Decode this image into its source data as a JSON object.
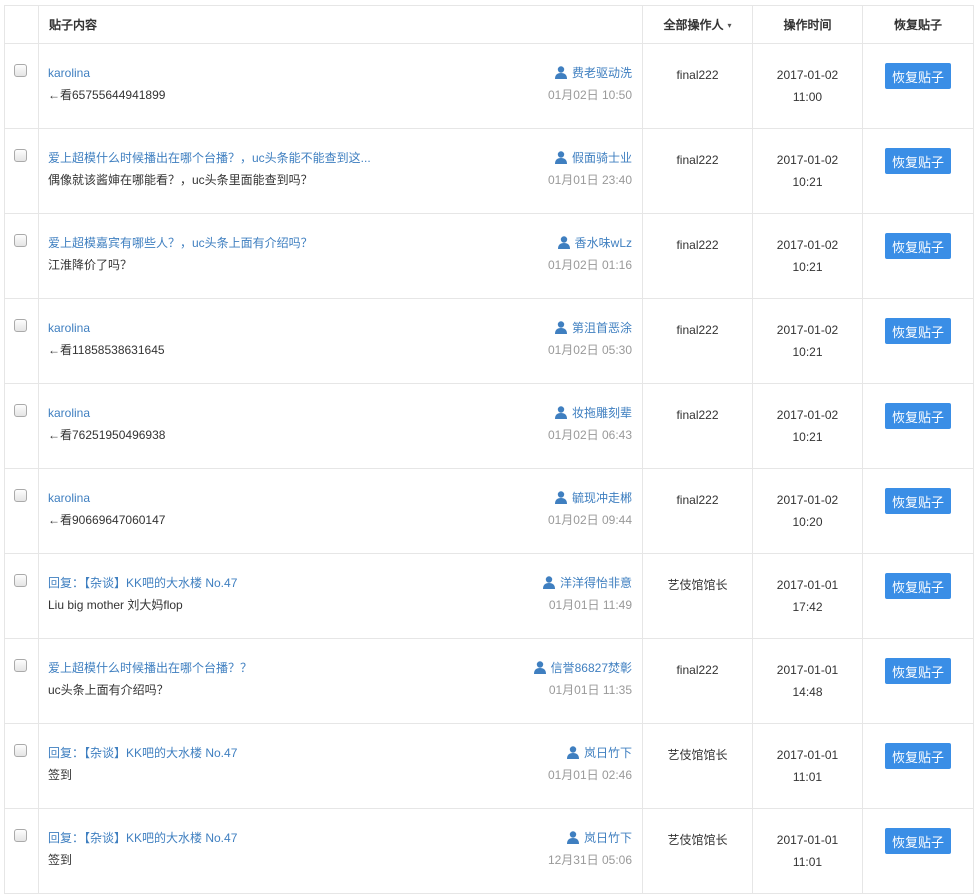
{
  "header": {
    "content": "贴子内容",
    "operator": "全部操作人",
    "operator_caret": "▾",
    "time": "操作时间",
    "restore": "恢复贴子"
  },
  "restore_button_label": "恢复贴子",
  "rows": [
    {
      "title": "karolina",
      "body": "←看65755644941899",
      "author": "费老驱动洗",
      "date": "01月02日 10:50",
      "operator": "final222",
      "time_date": "2017-01-02",
      "time_clock": "11:00"
    },
    {
      "title": "爱上超模什么时候播出在哪个台播？，uc头条能不能查到这...",
      "body": "偶像就该酱婶在哪能看？，uc头条里面能查到吗？",
      "author": "假面骑士业",
      "date": "01月01日 23:40",
      "operator": "final222",
      "time_date": "2017-01-02",
      "time_clock": "10:21"
    },
    {
      "title": "爱上超模嘉宾有哪些人？，uc头条上面有介绍吗？",
      "body": "江淮降价了吗？",
      "author": "香水味wLz",
      "date": "01月02日 01:16",
      "operator": "final222",
      "time_date": "2017-01-02",
      "time_clock": "10:21"
    },
    {
      "title": "karolina",
      "body": "←看11858538631645",
      "author": "第沮首恶涂",
      "date": "01月02日 05:30",
      "operator": "final222",
      "time_date": "2017-01-02",
      "time_clock": "10:21"
    },
    {
      "title": "karolina",
      "body": "←看76251950496938",
      "author": "妆拖雕刻辈",
      "date": "01月02日 06:43",
      "operator": "final222",
      "time_date": "2017-01-02",
      "time_clock": "10:21"
    },
    {
      "title": "karolina",
      "body": "←看90669647060147",
      "author": "毓现冲走郴",
      "date": "01月02日 09:44",
      "operator": "final222",
      "time_date": "2017-01-02",
      "time_clock": "10:20"
    },
    {
      "title": "回复：【杂谈】KK吧的大水楼 No.47",
      "body": "Liu big mother 刘大妈flop",
      "author": "洋洋得怡非意",
      "date": "01月01日 11:49",
      "operator": "艺伎馆馆长",
      "time_date": "2017-01-01",
      "time_clock": "17:42"
    },
    {
      "title": "爱上超模什么时候播出在哪个台播？？",
      "body": "uc头条上面有介绍吗？",
      "author": "信誉86827焚彰",
      "date": "01月01日 11:35",
      "operator": "final222",
      "time_date": "2017-01-01",
      "time_clock": "14:48"
    },
    {
      "title": "回复：【杂谈】KK吧的大水楼 No.47",
      "body": "签到",
      "author": "岚日竹下",
      "date": "01月01日 02:46",
      "operator": "艺伎馆馆长",
      "time_date": "2017-01-01",
      "time_clock": "11:01"
    },
    {
      "title": "回复：【杂谈】KK吧的大水楼 No.47",
      "body": "签到",
      "author": "岚日竹下",
      "date": "12月31日 05:06",
      "operator": "艺伎馆馆长",
      "time_date": "2017-01-01",
      "time_clock": "11:01"
    }
  ]
}
